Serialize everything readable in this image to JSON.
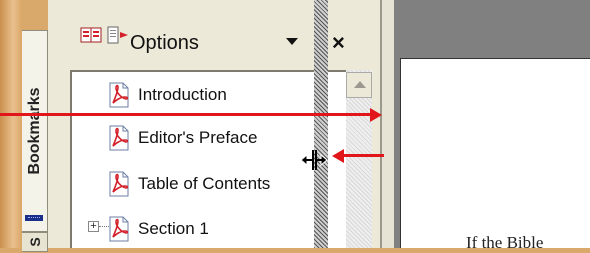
{
  "nav_panel": {
    "tabs": [
      {
        "label": "Bookmarks"
      },
      {
        "label": "S"
      }
    ],
    "toolbar": {
      "options_label": "Options",
      "close_label": "×"
    },
    "bookmarks": [
      {
        "label": "Introduction"
      },
      {
        "label": "Editor's Preface"
      },
      {
        "label": "Table of Contents"
      },
      {
        "label": "Section 1",
        "expander": "+"
      }
    ]
  },
  "document": {
    "visible_text": "If the Bible"
  },
  "colors": {
    "panel_bg": "#ece9d8",
    "annotation_arrow": "#e0161b",
    "pdf_icon_red": "#d3202a",
    "tab_highlight": "#1a2f8a"
  }
}
